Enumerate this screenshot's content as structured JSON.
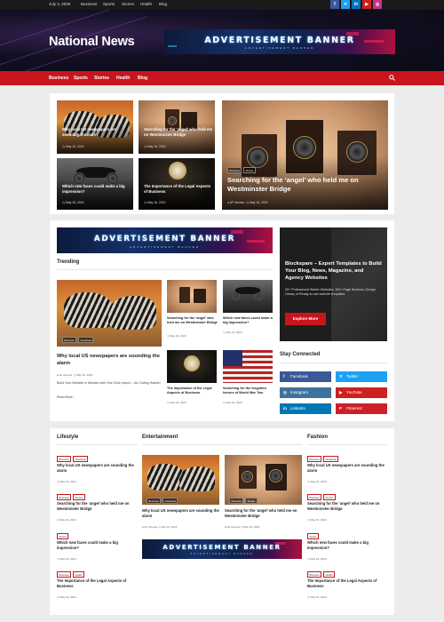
{
  "topbar": {
    "date": "July 3, 2025",
    "links": [
      "Business",
      "Sports",
      "Stories",
      "Health",
      "Blog"
    ],
    "social": [
      {
        "icon": "facebook-icon",
        "glyph": "f",
        "color": "#3b5998"
      },
      {
        "icon": "twitter-icon",
        "glyph": "✕",
        "color": "#1da1f2"
      },
      {
        "icon": "linkedin-icon",
        "glyph": "in",
        "color": "#0077b5"
      },
      {
        "icon": "youtube-icon",
        "glyph": "▶",
        "color": "#cd201f"
      },
      {
        "icon": "instagram-icon",
        "glyph": "◎",
        "color": "#c13584"
      }
    ]
  },
  "header": {
    "site_title": "National News",
    "ad_text": "ADVERTISEMENT BANNER",
    "ad_subtext": "ADVERTISEMENT BANNER"
  },
  "nav": {
    "items": [
      "Business",
      "Sports",
      "Stories",
      "Health",
      "Blog"
    ]
  },
  "featured": {
    "cards": [
      {
        "title": "Why local US newspapers are sounding the alarm",
        "date": "May 16, 2024"
      },
      {
        "title": "Searching for the ‘angel’ who held me on Westminster Bridge",
        "date": "May 16, 2024"
      },
      {
        "title": "Which new faces could make a big impression?",
        "date": "May 16, 2024"
      },
      {
        "title": "The Importance of the Legal Aspects of Business",
        "date": "May 16, 2024"
      }
    ],
    "main": {
      "badges": [
        "Business",
        "Stories"
      ],
      "title": "Searching for the ‘angel’ who held me on Westminster Bridge",
      "author": "AF themes",
      "date": "May 16, 2024"
    }
  },
  "trending": {
    "ad_text": "ADVERTISEMENT BANNER",
    "ad_subtext": "ADVERTISEMENT BANNER",
    "heading": "Trending",
    "main": {
      "badges": [
        "Business",
        "Newsbeat"
      ],
      "title": "Why local US newspapers are sounding the alarm",
      "author": "AF themes",
      "date": "May 16, 2024",
      "excerpt": "Build Your Website in Minutes with One-Click Import – No Coding Hassle!",
      "read_more": "Read More.."
    },
    "cards": [
      {
        "title": "Searching for the ‘angel’ who held me on Westminster Bridge",
        "date": "May 16, 2024"
      },
      {
        "title": "Which new faces could make a big impression?",
        "date": "May 16, 2024"
      },
      {
        "title": "The Importance of the Legal Aspects of Business",
        "date": "May 16, 2024"
      },
      {
        "title": "Searching for the forgotten heroes of World War Two",
        "date": "May 16, 2024"
      }
    ]
  },
  "sidebar": {
    "promo_title": "Blockspare – Expert Templates to Build Your Blog, News, Magazine, and Agency Websites",
    "promo_text": "30+ Professional Starter Websites, 300+ Page Sections, Design Library of Ready-to-use website templates",
    "promo_button": "Explore More",
    "stay_connected": "Stay Connected",
    "social_buttons": [
      {
        "label": "Facebook",
        "icon": "facebook-icon",
        "glyph": "f",
        "color": "#3b5998"
      },
      {
        "label": "Twitter",
        "icon": "twitter-icon",
        "glyph": "✕",
        "color": "#1da1f2"
      },
      {
        "label": "Instagram",
        "icon": "instagram-icon",
        "glyph": "◎",
        "color": "#3f729b"
      },
      {
        "label": "YouTube",
        "icon": "youtube-icon",
        "glyph": "▶",
        "color": "#cd201f"
      },
      {
        "label": "LinkedIn",
        "icon": "linkedin-icon",
        "glyph": "in",
        "color": "#0077b5"
      },
      {
        "label": "Pinterest",
        "icon": "pinterest-icon",
        "glyph": "P",
        "color": "#cb2027"
      }
    ]
  },
  "lifestyle": {
    "heading": "Lifestyle",
    "items": [
      {
        "badges": [
          "Business",
          "Newsbeat"
        ],
        "title": "Why local US newspapers are sounding the alarm",
        "date": "May 16, 2024"
      },
      {
        "badges": [
          "Business",
          "Stories"
        ],
        "title": "Searching for the ‘angel’ who held me on Westminster Bridge",
        "date": "May 16, 2024"
      },
      {
        "badges": [
          "Sports"
        ],
        "title": "Which new faces could make a big impression?",
        "date": "May 16, 2024"
      },
      {
        "badges": [
          "Business",
          "Health"
        ],
        "title": "The Importance of the Legal Aspects of Business",
        "date": "May 16, 2024"
      }
    ]
  },
  "entertainment": {
    "heading": "Entertainment",
    "cards": [
      {
        "badges": [
          "Business",
          "Newsbeat"
        ],
        "title": "Why local US newspapers are sounding the alarm",
        "author": "AF themes",
        "date": "May 16, 2024"
      },
      {
        "badges": [
          "Business",
          "Stories"
        ],
        "title": "Searching for the ‘angel’ who held me on Westminster Bridge",
        "author": "AF themes",
        "date": "May 16, 2024"
      }
    ],
    "ad_text": "ADVERTISEMENT BANNER",
    "ad_subtext": "ADVERTISEMENT BANNER"
  },
  "fashion": {
    "heading": "Fashion",
    "items": [
      {
        "badges": [
          "Business",
          "Newsbeat"
        ],
        "title": "Why local US newspapers are sounding the alarm",
        "date": "May 16, 2024"
      },
      {
        "badges": [
          "Business",
          "Stories"
        ],
        "title": "Searching for the ‘angel’ who held me on Westminster Bridge",
        "date": "May 16, 2024"
      },
      {
        "badges": [
          "Sports"
        ],
        "title": "Which new faces could make a big impression?",
        "date": "May 16, 2024"
      },
      {
        "badges": [
          "Business",
          "Health"
        ],
        "title": "The Importance of the Legal Aspects of Business",
        "date": "May 16, 2024"
      }
    ]
  },
  "colors": {
    "accent": "#c8151d",
    "dark": "#1a1a1a"
  }
}
